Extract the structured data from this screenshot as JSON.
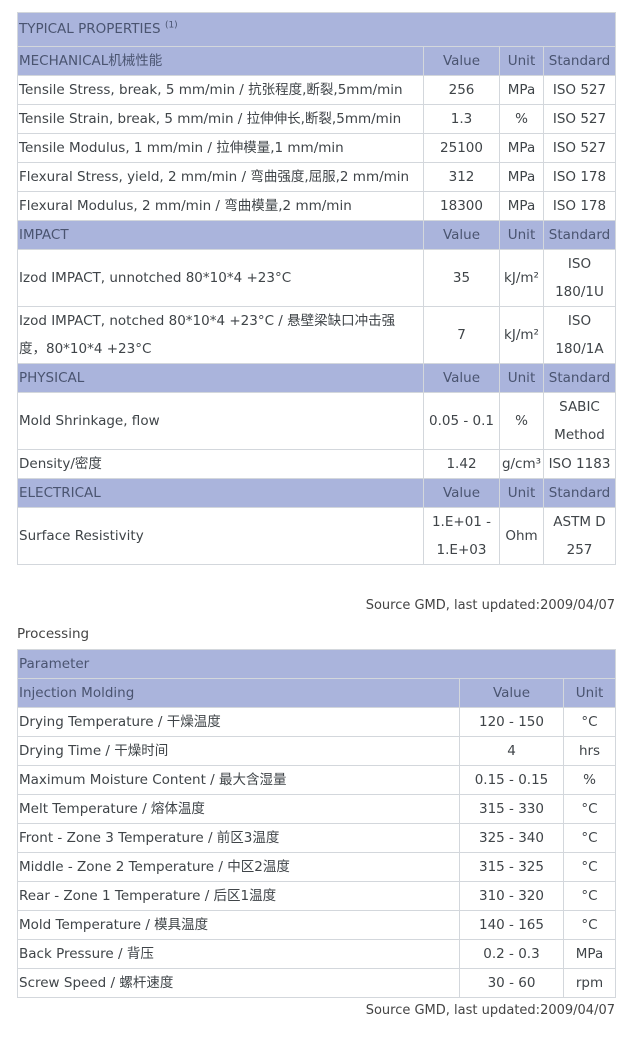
{
  "typical": {
    "title": "TYPICAL PROPERTIES",
    "title_sup": "(1)",
    "sections": [
      {
        "header": [
          "MECHANICAL机械性能",
          "Value",
          "Unit",
          "Standard"
        ],
        "rows": [
          [
            "Tensile Stress, break, 5 mm/min / 抗张程度,断裂,5mm/min",
            "256",
            "MPa",
            "ISO 527"
          ],
          [
            "Tensile Strain, break, 5 mm/min / 拉伸伸长,断裂,5mm/min",
            "1.3",
            "%",
            "ISO 527"
          ],
          [
            "Tensile Modulus, 1 mm/min / 拉伸模量,1 mm/min",
            "25100",
            "MPa",
            "ISO 527"
          ],
          [
            "Flexural Stress, yield, 2 mm/min / 弯曲强度,屈服,2 mm/min",
            "312",
            "MPa",
            "ISO 178"
          ],
          [
            "Flexural Modulus, 2 mm/min / 弯曲模量,2 mm/min",
            "18300",
            "MPa",
            "ISO 178"
          ]
        ]
      },
      {
        "header": [
          "IMPACT",
          "Value",
          "Unit",
          "Standard"
        ],
        "rows": [
          [
            "Izod IMPACT, unnotched 80*10*4 +23°C",
            "35",
            "kJ/m²",
            "ISO 180/1U"
          ],
          [
            "Izod IMPACT, notched 80*10*4 +23°C / 悬壁梁缺口冲击强度，80*10*4 +23°C",
            "7",
            "kJ/m²",
            "ISO 180/1A"
          ]
        ]
      },
      {
        "header": [
          "PHYSICAL",
          "Value",
          "Unit",
          "Standard"
        ],
        "rows": [
          [
            "Mold Shrinkage, flow",
            "0.05 - 0.1",
            "%",
            "SABIC Method"
          ],
          [
            "Density/密度",
            "1.42",
            "g/cm³",
            "ISO 1183"
          ]
        ]
      },
      {
        "header": [
          "ELECTRICAL",
          "Value",
          "Unit",
          "Standard"
        ],
        "rows": [
          [
            "Surface Resistivity",
            "1.E+01 - 1.E+03",
            "Ohm",
            "ASTM D 257"
          ]
        ]
      }
    ],
    "source": "Source GMD, last updated:2009/04/07"
  },
  "processing": {
    "title": "Processing",
    "param_label": "Parameter",
    "header": [
      "Injection Molding",
      "Value",
      "Unit"
    ],
    "rows": [
      [
        "Drying Temperature / 干燥温度",
        "120 - 150",
        "°C"
      ],
      [
        "Drying Time / 干燥时间",
        "4",
        "hrs"
      ],
      [
        "Maximum Moisture Content / 最大含湿量",
        "0.15 - 0.15",
        "%"
      ],
      [
        "Melt Temperature / 熔体温度",
        "315 - 330",
        "°C"
      ],
      [
        "Front - Zone 3 Temperature / 前区3温度",
        "325 - 340",
        "°C"
      ],
      [
        "Middle - Zone 2 Temperature / 中区2温度",
        "315 - 325",
        "°C"
      ],
      [
        "Rear - Zone 1 Temperature / 后区1温度",
        "310 - 320",
        "°C"
      ],
      [
        "Mold Temperature / 模具温度",
        "140 - 165",
        "°C"
      ],
      [
        "Back Pressure / 背压",
        "0.2 - 0.3",
        "MPa"
      ],
      [
        "Screw Speed / 螺杆速度",
        "30 - 60",
        "rpm"
      ]
    ],
    "source": "Source GMD, last updated:2009/04/07"
  }
}
